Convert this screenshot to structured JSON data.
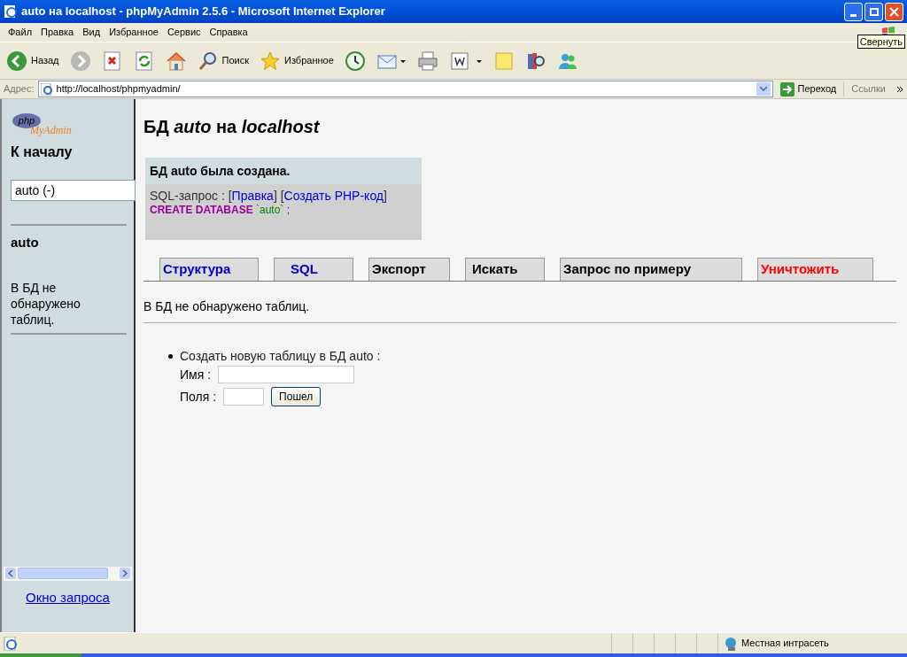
{
  "window": {
    "title": "auto на localhost - phpMyAdmin 2.5.6 - Microsoft Internet Explorer",
    "tooltip": "Свернуть"
  },
  "menu": [
    "Файл",
    "Правка",
    "Вид",
    "Избранное",
    "Сервис",
    "Справка"
  ],
  "toolbar": [
    {
      "kind": "back",
      "label": "Назад"
    },
    {
      "kind": "forward"
    },
    {
      "kind": "stop"
    },
    {
      "kind": "refresh"
    },
    {
      "kind": "home"
    },
    {
      "kind": "search",
      "label": "Поиск"
    },
    {
      "kind": "favorites",
      "label": "Избранное"
    },
    {
      "kind": "history"
    },
    {
      "kind": "mail"
    },
    {
      "kind": "print"
    },
    {
      "kind": "edit"
    },
    {
      "kind": "note"
    },
    {
      "kind": "research"
    },
    {
      "kind": "messenger"
    }
  ],
  "address": {
    "label": "Адрес:",
    "url": "http://localhost/phpmyadmin/",
    "go": "Переход",
    "links": "Ссылки"
  },
  "sidebar": {
    "logo": {
      "php": "php",
      "myadmin": "MyAdmin"
    },
    "home": "К началу",
    "db_select": "auto (-)",
    "db_name": "auto",
    "message": "В БД не обнаружено таблиц.",
    "query_window": "Окно запроса"
  },
  "main": {
    "heading": {
      "prefix": "БД",
      "db": "auto",
      "middle": "на",
      "host": "localhost"
    },
    "notice": {
      "title": "БД auto была создана.",
      "query_label": "SQL-запрос : [",
      "edit_link": "Правка",
      "between": "] [",
      "php_link": "Создать PHP-код",
      "end": "]",
      "keyword": "CREATE DATABASE",
      "identifier": "`auto`",
      "terminator": ";"
    },
    "tabs": [
      {
        "label": "Структура",
        "color": "#0000cc"
      },
      {
        "label": "SQL",
        "color": "#0000cc"
      },
      {
        "label": "Экспорт",
        "color": "#000000"
      },
      {
        "label": "Искать",
        "color": "#000000"
      },
      {
        "label": "Запрос по примеру",
        "color": "#000000"
      },
      {
        "label": "Уничтожить",
        "color": "#ff0000"
      }
    ],
    "empty_message": "В БД не обнаружено таблиц.",
    "create": {
      "title": "Создать новую таблицу в БД auto :",
      "name_label": "Имя :",
      "fields_label": "Поля :",
      "button": "Пошел"
    }
  },
  "status_bar": {
    "zone": "Местная интрасеть"
  }
}
